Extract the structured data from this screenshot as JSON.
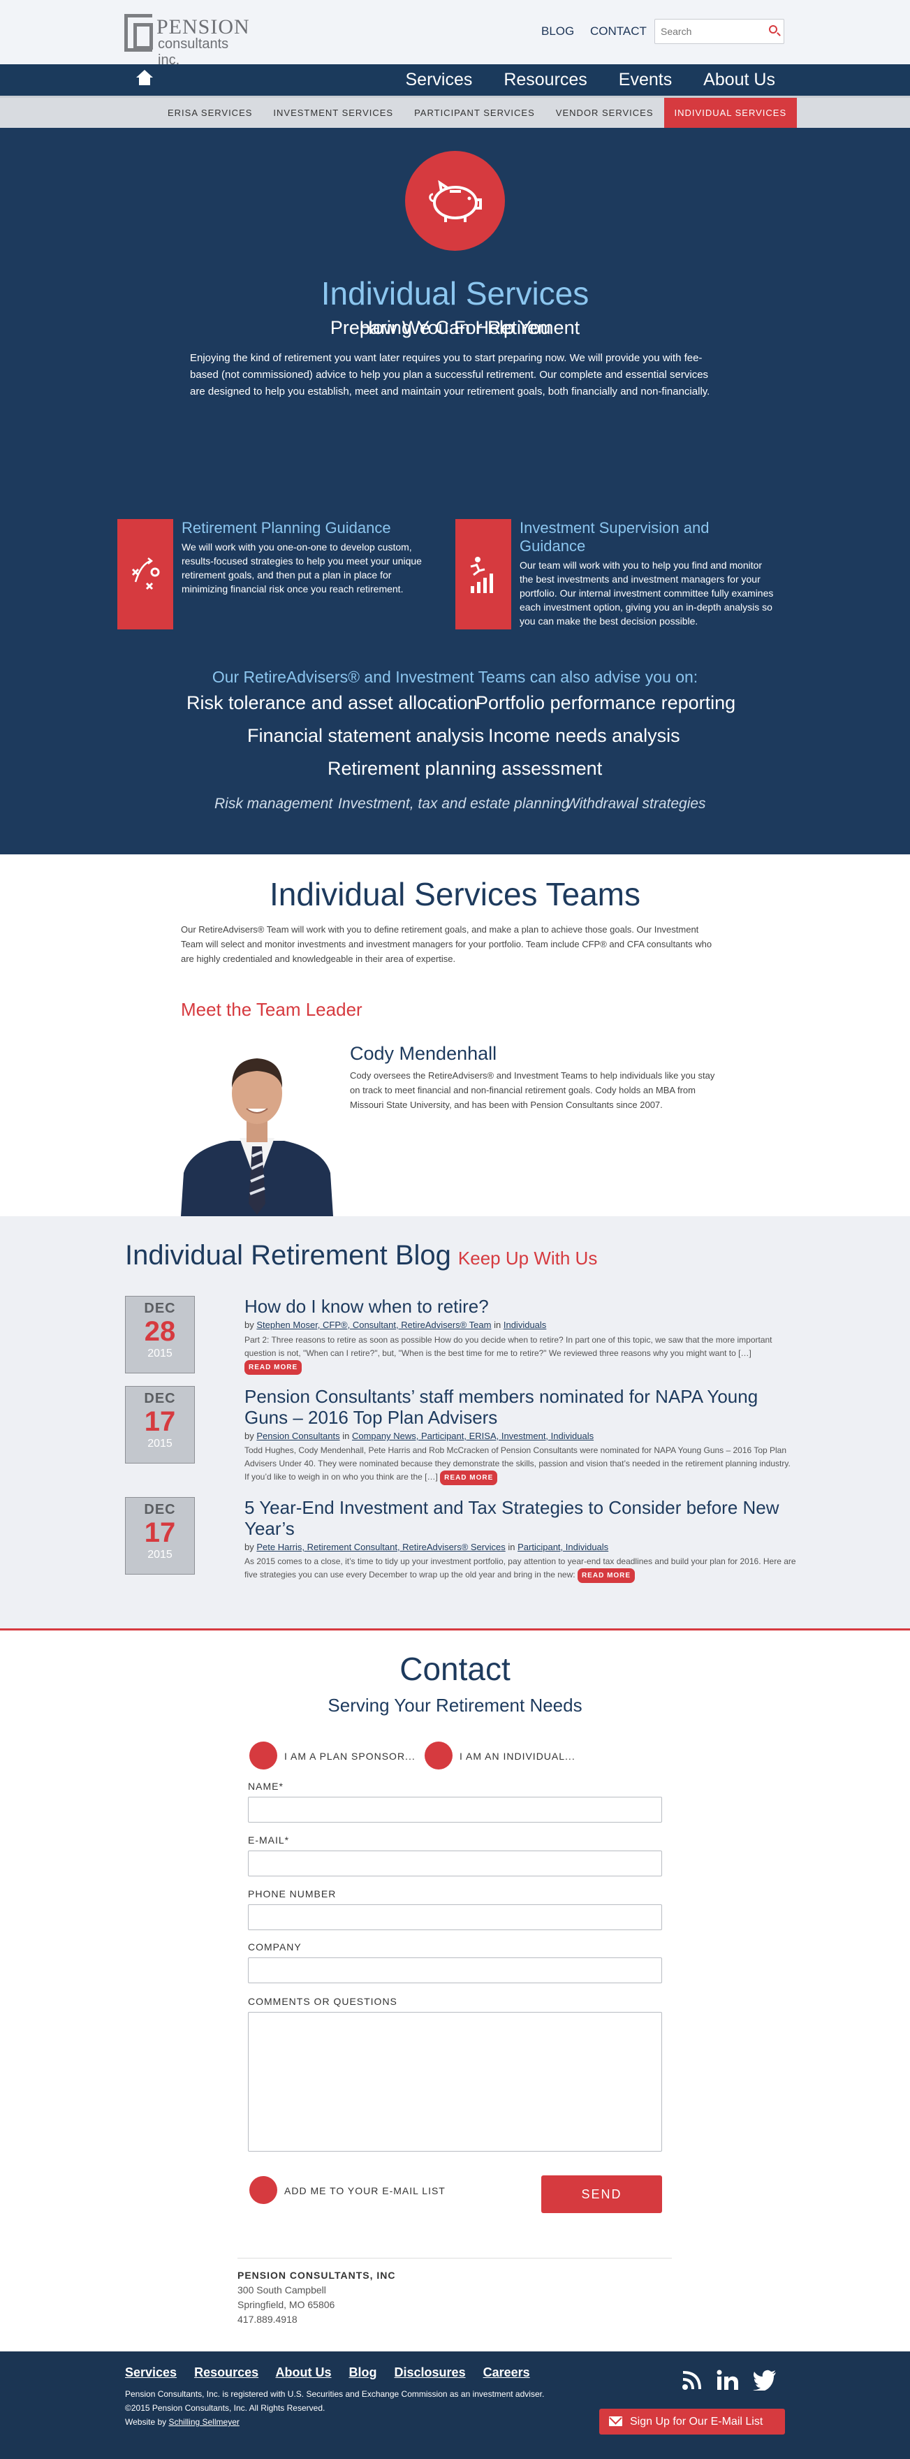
{
  "header": {
    "logo_name": "PENSION",
    "logo_sub": "consultants inc.",
    "links": [
      "BLOG",
      "CONTACT"
    ],
    "search_placeholder": "Search"
  },
  "nav": {
    "items": [
      "Services",
      "Resources",
      "Events",
      "About Us"
    ]
  },
  "subnav": {
    "items": [
      "ERISA SERVICES",
      "INVESTMENT SERVICES",
      "PARTICIPANT SERVICES",
      "VENDOR SERVICES",
      "INDIVIDUAL SERVICES"
    ],
    "active": "INDIVIDUAL SERVICES"
  },
  "hero": {
    "title": "Individual Services",
    "subtitle": "Preparing You For Retirement",
    "intro": "Enjoying the kind of retirement you want later requires you to start preparing now. We will provide you with fee-based (not commissioned) advice to help you plan a successful retirement. Our complete and essential services are designed to help you establish, meet and maintain your retirement goals, both financially and non-financially.",
    "how_title": "How We Can Help You",
    "services": [
      {
        "title": "Retirement Planning Guidance",
        "text": "We will work with you one-on-one to develop custom, results-focused strategies to help you meet your unique retirement goals, and then put a plan in place for minimizing financial risk once you reach retirement."
      },
      {
        "title": "Investment Supervision and Guidance",
        "text": "Our team will work with you to help you find and monitor the best investments and investment managers for your portfolio. Our internal investment committee fully examines each investment option, giving you an in-depth analysis so you can make the best decision possible."
      }
    ],
    "also_title": "Our RetireAdvisers® and Investment Teams can also advise you on:",
    "topics": [
      "Risk tolerance and asset allocation",
      "Portfolio performance reporting",
      "Financial statement analysis",
      "Income needs analysis",
      "Retirement planning assessment"
    ],
    "minor_topics": [
      "Risk management",
      "Investment, tax and estate planning",
      "Withdrawal strategies"
    ]
  },
  "teams": {
    "title": "Individual Services Teams",
    "text": "Our RetireAdvisers® Team will work with you to define retirement goals, and make a plan to achieve those goals. Our Investment Team will select and monitor investments and investment managers for your portfolio. Team include CFP® and CFA consultants who are highly credentialed and knowledgeable in their area of expertise.",
    "meet": "Meet the Team Leader",
    "leader_name": "Cody Mendenhall",
    "leader_bio": "Cody oversees the RetireAdvisers® and Investment Teams to help individuals like you stay on track to meet financial and non-financial retirement goals. Cody holds an MBA from Missouri State University, and  has been with Pension Consultants since 2007."
  },
  "blog": {
    "title": "Individual Retirement Blog",
    "tagline": "Keep Up With Us",
    "read_more": "READ MORE",
    "posts": [
      {
        "month": "DEC",
        "day": "28",
        "year": "2015",
        "title": "How do I know when to retire?",
        "by": "by",
        "author": "Stephen Moser, CFP®, Consultant, RetireAdvisers® Team",
        "in": "in",
        "categories": "Individuals",
        "excerpt": "Part 2: Three reasons to retire as soon as possible How do you decide when to retire? In part one of this topic, we saw that the more important question is not, \"When can I retire?\", but, \"When is the best time for me to retire?\" We reviewed three reasons why you might want to […]"
      },
      {
        "month": "DEC",
        "day": "17",
        "year": "2015",
        "title": "Pension Consultants’ staff members nominated for NAPA Young Guns – 2016 Top Plan Advisers",
        "by": "by",
        "author": "Pension Consultants",
        "in": "in",
        "categories": "Company News, Participant, ERISA, Investment, Individuals",
        "excerpt": "Todd Hughes, Cody Mendenhall, Pete Harris and Rob McCracken of Pension Consultants were nominated for NAPA Young Guns – 2016 Top Plan Advisers Under 40. They were nominated because they demonstrate the skills, passion and vision that’s needed in the retirement planning industry. If you’d like to weigh in on who you think are the […]"
      },
      {
        "month": "DEC",
        "day": "17",
        "year": "2015",
        "title": "5 Year-End Investment and Tax Strategies to Consider before New Year’s",
        "by": "by",
        "author": "Pete Harris, Retirement Consultant, RetireAdvisers® Services",
        "in": "in",
        "categories": "Participant, Individuals",
        "excerpt": "As 2015 comes to a close, it’s time to tidy up your investment portfolio, pay attention to year-end tax deadlines and build your plan for 2016. Here are five strategies you can use every December to wrap up the old year and bring in the new:"
      }
    ]
  },
  "contact": {
    "title": "Contact",
    "subtitle": "Serving Your Retirement Needs",
    "radio_sponsor": "I AM A PLAN SPONSOR...",
    "radio_individual": "I AM AN INDIVIDUAL...",
    "fields": [
      "NAME*",
      "E-MAIL*",
      "PHONE NUMBER",
      "COMPANY"
    ],
    "comments_label": "COMMENTS OR QUESTIONS",
    "email_list": "ADD ME TO YOUR E-MAIL LIST",
    "send": "SEND",
    "company_name": "PENSION CONSULTANTS, INC",
    "address1": "300 South Campbell",
    "address2": "Springfield, MO 65806",
    "phone": "417.889.4918"
  },
  "footer": {
    "links": [
      "Services",
      "Resources",
      "About Us",
      "Blog",
      "Disclosures",
      "Careers"
    ],
    "legal": "Pension Consultants, Inc. is registered with U.S. Securities and Exchange Commission as an investment adviser. ©2015 Pension Consultants, Inc. All Rights Reserved.",
    "website_by": "Website by",
    "agency": "Schilling Sellmeyer",
    "signup": "Sign Up for Our E-Mail List"
  },
  "colors": {
    "navy": "#1d3a5d",
    "accent_red": "#d63a3f",
    "light_blue": "#8cc6ef"
  }
}
